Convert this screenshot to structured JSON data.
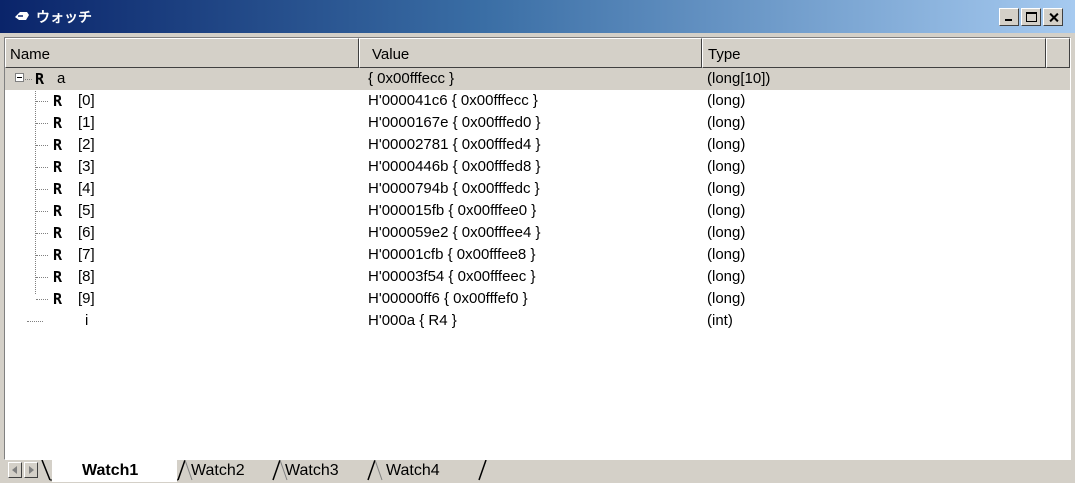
{
  "window": {
    "title": "ウォッチ"
  },
  "columns": {
    "name": "Name",
    "value": "Value",
    "type": "Type"
  },
  "reg_glyph": "R",
  "rows": [
    {
      "name": "a",
      "value": "{ 0x00fffecc }",
      "type": "(long[10])",
      "selected": true
    },
    {
      "name": "[0]",
      "value": "H'000041c6 { 0x00fffecc }",
      "type": "(long)"
    },
    {
      "name": "[1]",
      "value": "H'0000167e { 0x00fffed0 }",
      "type": "(long)"
    },
    {
      "name": "[2]",
      "value": "H'00002781 { 0x00fffed4 }",
      "type": "(long)"
    },
    {
      "name": "[3]",
      "value": "H'0000446b { 0x00fffed8 }",
      "type": "(long)"
    },
    {
      "name": "[4]",
      "value": "H'0000794b { 0x00fffedc }",
      "type": "(long)"
    },
    {
      "name": "[5]",
      "value": "H'000015fb { 0x00fffee0 }",
      "type": "(long)"
    },
    {
      "name": "[6]",
      "value": "H'000059e2 { 0x00fffee4 }",
      "type": "(long)"
    },
    {
      "name": "[7]",
      "value": "H'00001cfb { 0x00fffee8 }",
      "type": "(long)"
    },
    {
      "name": "[8]",
      "value": "H'00003f54 { 0x00fffeec }",
      "type": "(long)"
    },
    {
      "name": "[9]",
      "value": "H'00000ff6 { 0x00fffef0 }",
      "type": "(long)"
    },
    {
      "name": "i",
      "value": "H'000a { R4 }",
      "type": "(int)"
    }
  ],
  "tabs": [
    {
      "label": "Watch1",
      "active": true
    },
    {
      "label": "Watch2"
    },
    {
      "label": "Watch3"
    },
    {
      "label": "Watch4"
    }
  ],
  "icons": {
    "app": "watch-window-icon",
    "minimize": "minimize-icon",
    "maximize": "maximize-icon",
    "close": "close-icon",
    "collapse": "collapse-icon",
    "register": "register-icon",
    "tab_scroll_left": "scroll-left-icon",
    "tab_scroll_right": "scroll-right-icon"
  },
  "colors": {
    "title_gradient_start": "#0a246a",
    "title_gradient_end": "#a6caf0",
    "face": "#d4d0c8",
    "selected_row": "#d4d0c8"
  }
}
